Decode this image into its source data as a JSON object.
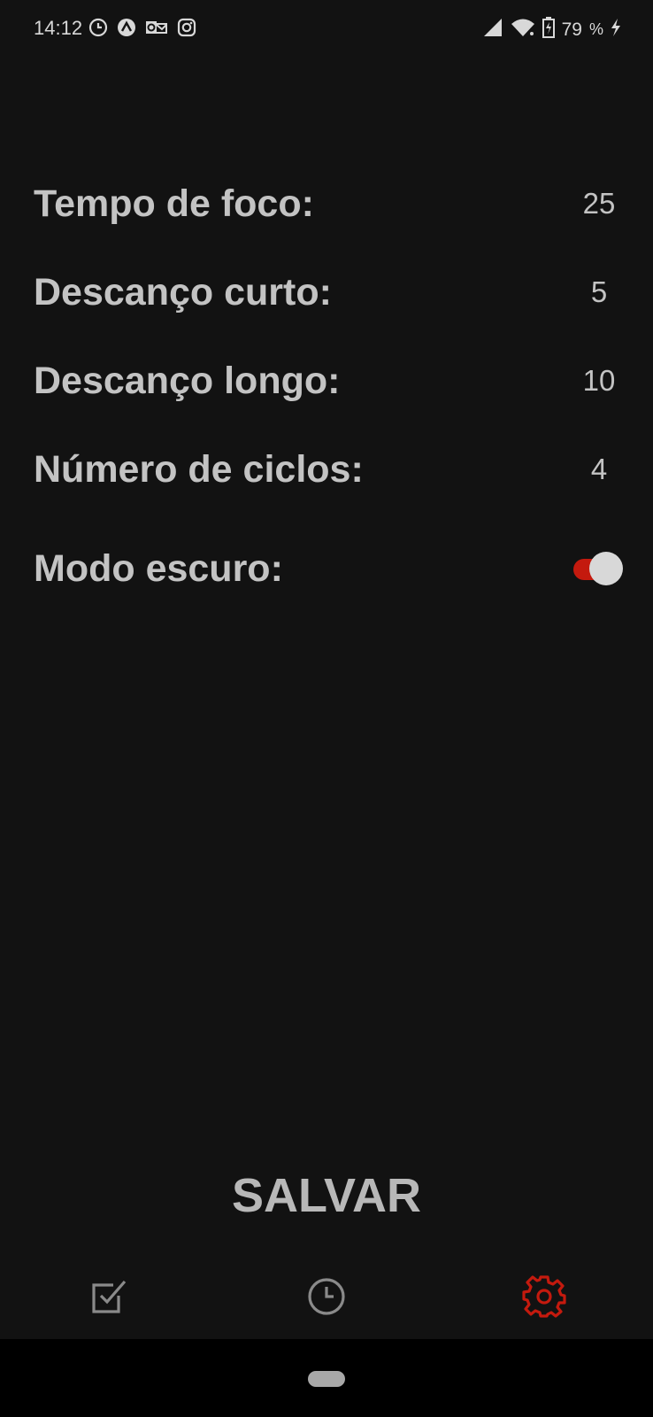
{
  "status_bar": {
    "time": "14:12",
    "battery_level": "79",
    "battery_suffix": "%"
  },
  "settings": {
    "rows": [
      {
        "label": "Tempo de foco:",
        "value": "25"
      },
      {
        "label": "Descanço curto:",
        "value": "5"
      },
      {
        "label": "Descanço longo:",
        "value": "10"
      },
      {
        "label": "Número de ciclos:",
        "value": "4"
      }
    ],
    "dark_mode": {
      "label": "Modo escuro:",
      "enabled": true
    }
  },
  "save_button": {
    "label": "SALVAR"
  },
  "tabs": [
    {
      "icon": "checkbox-icon",
      "active": false
    },
    {
      "icon": "clock-icon",
      "active": false
    },
    {
      "icon": "gear-icon",
      "active": true
    }
  ],
  "colors": {
    "background": "#121212",
    "text": "#c3c3c3",
    "accent": "#c41a0e",
    "inactive_icon": "#8a8a8a",
    "nav_bar": "#000000"
  }
}
